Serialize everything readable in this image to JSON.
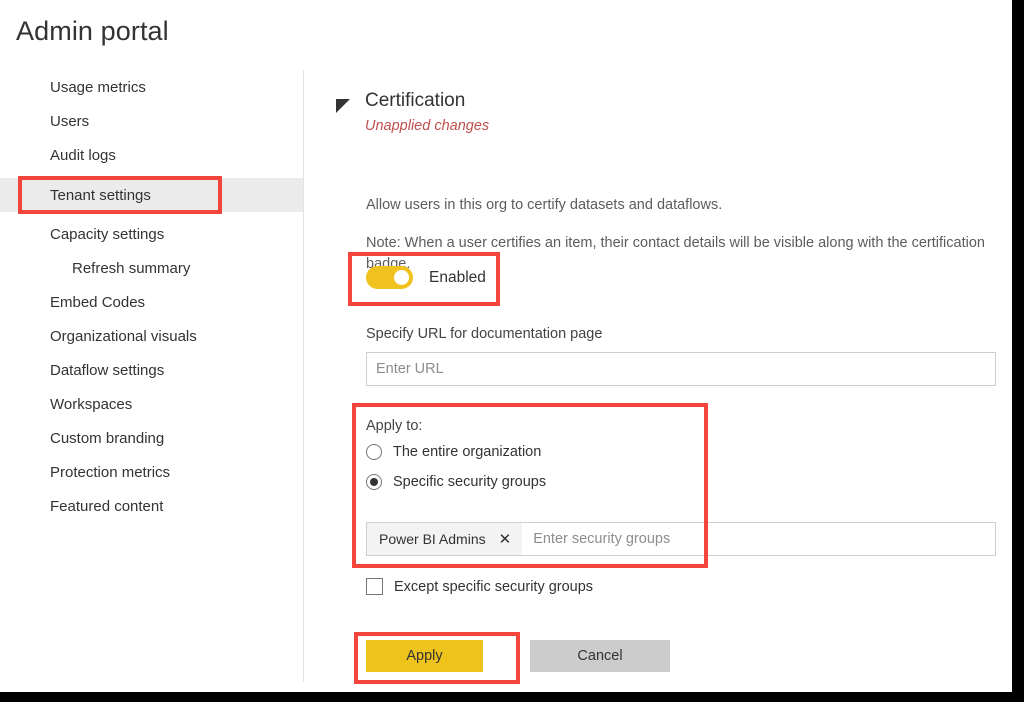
{
  "page": {
    "title": "Admin portal"
  },
  "sidebar": {
    "items": [
      {
        "label": "Usage metrics",
        "selected": false,
        "sub": false
      },
      {
        "label": "Users",
        "selected": false,
        "sub": false
      },
      {
        "label": "Audit logs",
        "selected": false,
        "sub": false
      },
      {
        "label": "Tenant settings",
        "selected": true,
        "sub": false
      },
      {
        "label": "Capacity settings",
        "selected": false,
        "sub": false
      },
      {
        "label": "Refresh summary",
        "selected": false,
        "sub": true
      },
      {
        "label": "Embed Codes",
        "selected": false,
        "sub": false
      },
      {
        "label": "Organizational visuals",
        "selected": false,
        "sub": false
      },
      {
        "label": "Dataflow settings",
        "selected": false,
        "sub": false
      },
      {
        "label": "Workspaces",
        "selected": false,
        "sub": false
      },
      {
        "label": "Custom branding",
        "selected": false,
        "sub": false
      },
      {
        "label": "Protection metrics",
        "selected": false,
        "sub": false
      },
      {
        "label": "Featured content",
        "selected": false,
        "sub": false
      }
    ]
  },
  "setting": {
    "collapse_icon": "triangle-expanded-icon",
    "title": "Certification",
    "status": "Unapplied changes",
    "description_1": "Allow users in this org to certify datasets and dataflows.",
    "description_2": "Note: When a user certifies an item, their contact details will be visible along with the certification badge.",
    "toggle": {
      "state": "on",
      "label": "Enabled"
    },
    "url_field": {
      "label": "Specify URL for documentation page",
      "value": "",
      "placeholder": "Enter URL"
    },
    "apply_to": {
      "label": "Apply to:",
      "options": [
        {
          "label": "The entire organization",
          "selected": false
        },
        {
          "label": "Specific security groups",
          "selected": true
        }
      ]
    },
    "security_groups": {
      "tokens": [
        {
          "label": "Power BI Admins",
          "remove_icon": "✕"
        }
      ],
      "placeholder": "Enter security groups"
    },
    "except_checkbox": {
      "label": "Except specific security groups",
      "checked": false
    },
    "buttons": {
      "apply": "Apply",
      "cancel": "Cancel"
    }
  },
  "colors": {
    "accent_yellow": "#efc21f",
    "apply_button": "#eec31b",
    "cancel_button": "#cccccc",
    "status_red": "#c0504d",
    "annotation_red": "#f4453c",
    "selected_nav": "#ebebeb"
  }
}
